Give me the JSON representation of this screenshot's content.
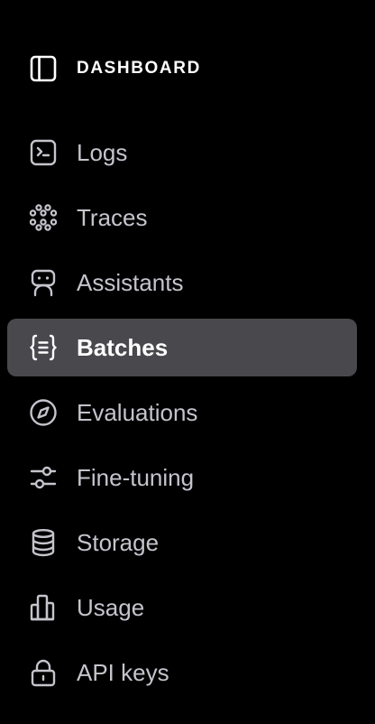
{
  "sidebar": {
    "title": "DASHBOARD",
    "items": [
      {
        "label": "Logs",
        "icon": "terminal-icon",
        "active": false
      },
      {
        "label": "Traces",
        "icon": "dots-grid-icon",
        "active": false
      },
      {
        "label": "Assistants",
        "icon": "robot-icon",
        "active": false
      },
      {
        "label": "Batches",
        "icon": "braces-list-icon",
        "active": true
      },
      {
        "label": "Evaluations",
        "icon": "compass-icon",
        "active": false
      },
      {
        "label": "Fine-tuning",
        "icon": "sliders-icon",
        "active": false
      },
      {
        "label": "Storage",
        "icon": "database-icon",
        "active": false
      },
      {
        "label": "Usage",
        "icon": "bar-chart-icon",
        "active": false
      },
      {
        "label": "API keys",
        "icon": "lock-icon",
        "active": false
      }
    ]
  },
  "colors": {
    "background": "#000000",
    "active_background": "#48484d",
    "text": "#c4c4cc",
    "active_text": "#ffffff",
    "icon": "#c4c4cc"
  }
}
